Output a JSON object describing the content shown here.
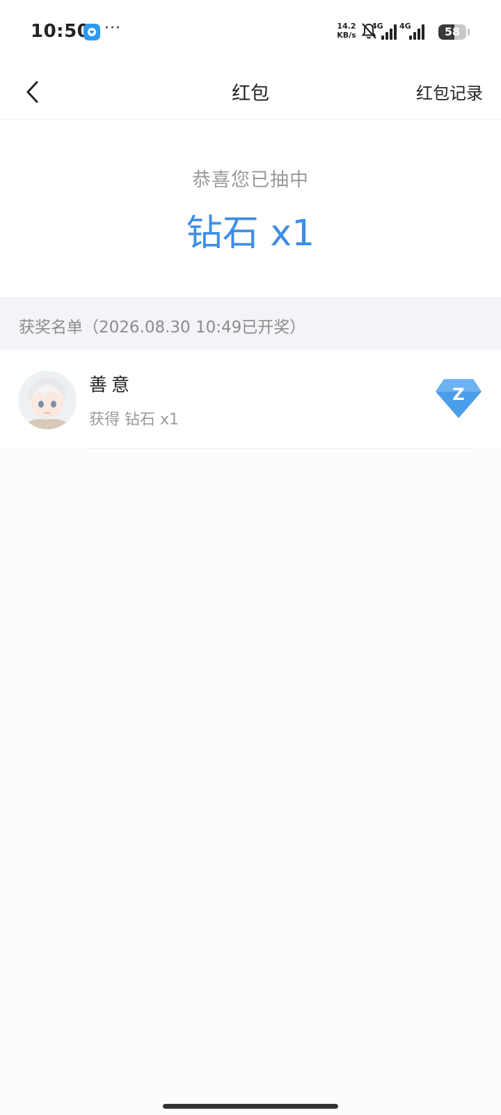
{
  "status_bar": {
    "time": "10:50",
    "more": "···",
    "speed_value": "14.2",
    "speed_unit": "KB/s",
    "net1_label": "4G",
    "net2_label": "4G",
    "battery": "58",
    "battery_level": 0.58
  },
  "nav": {
    "title": "红包",
    "record_label": "红包记录"
  },
  "result": {
    "subtitle": "恭喜您已抽中",
    "prize": "钻石 x1"
  },
  "winners": {
    "header": "获奖名单（2026.08.30 10:49已开奖）",
    "items": [
      {
        "name": "善意",
        "prize_text": "获得 钻石 x1"
      }
    ]
  },
  "colors": {
    "accent": "#3d8ee6",
    "diamond": "#4a9de8"
  }
}
